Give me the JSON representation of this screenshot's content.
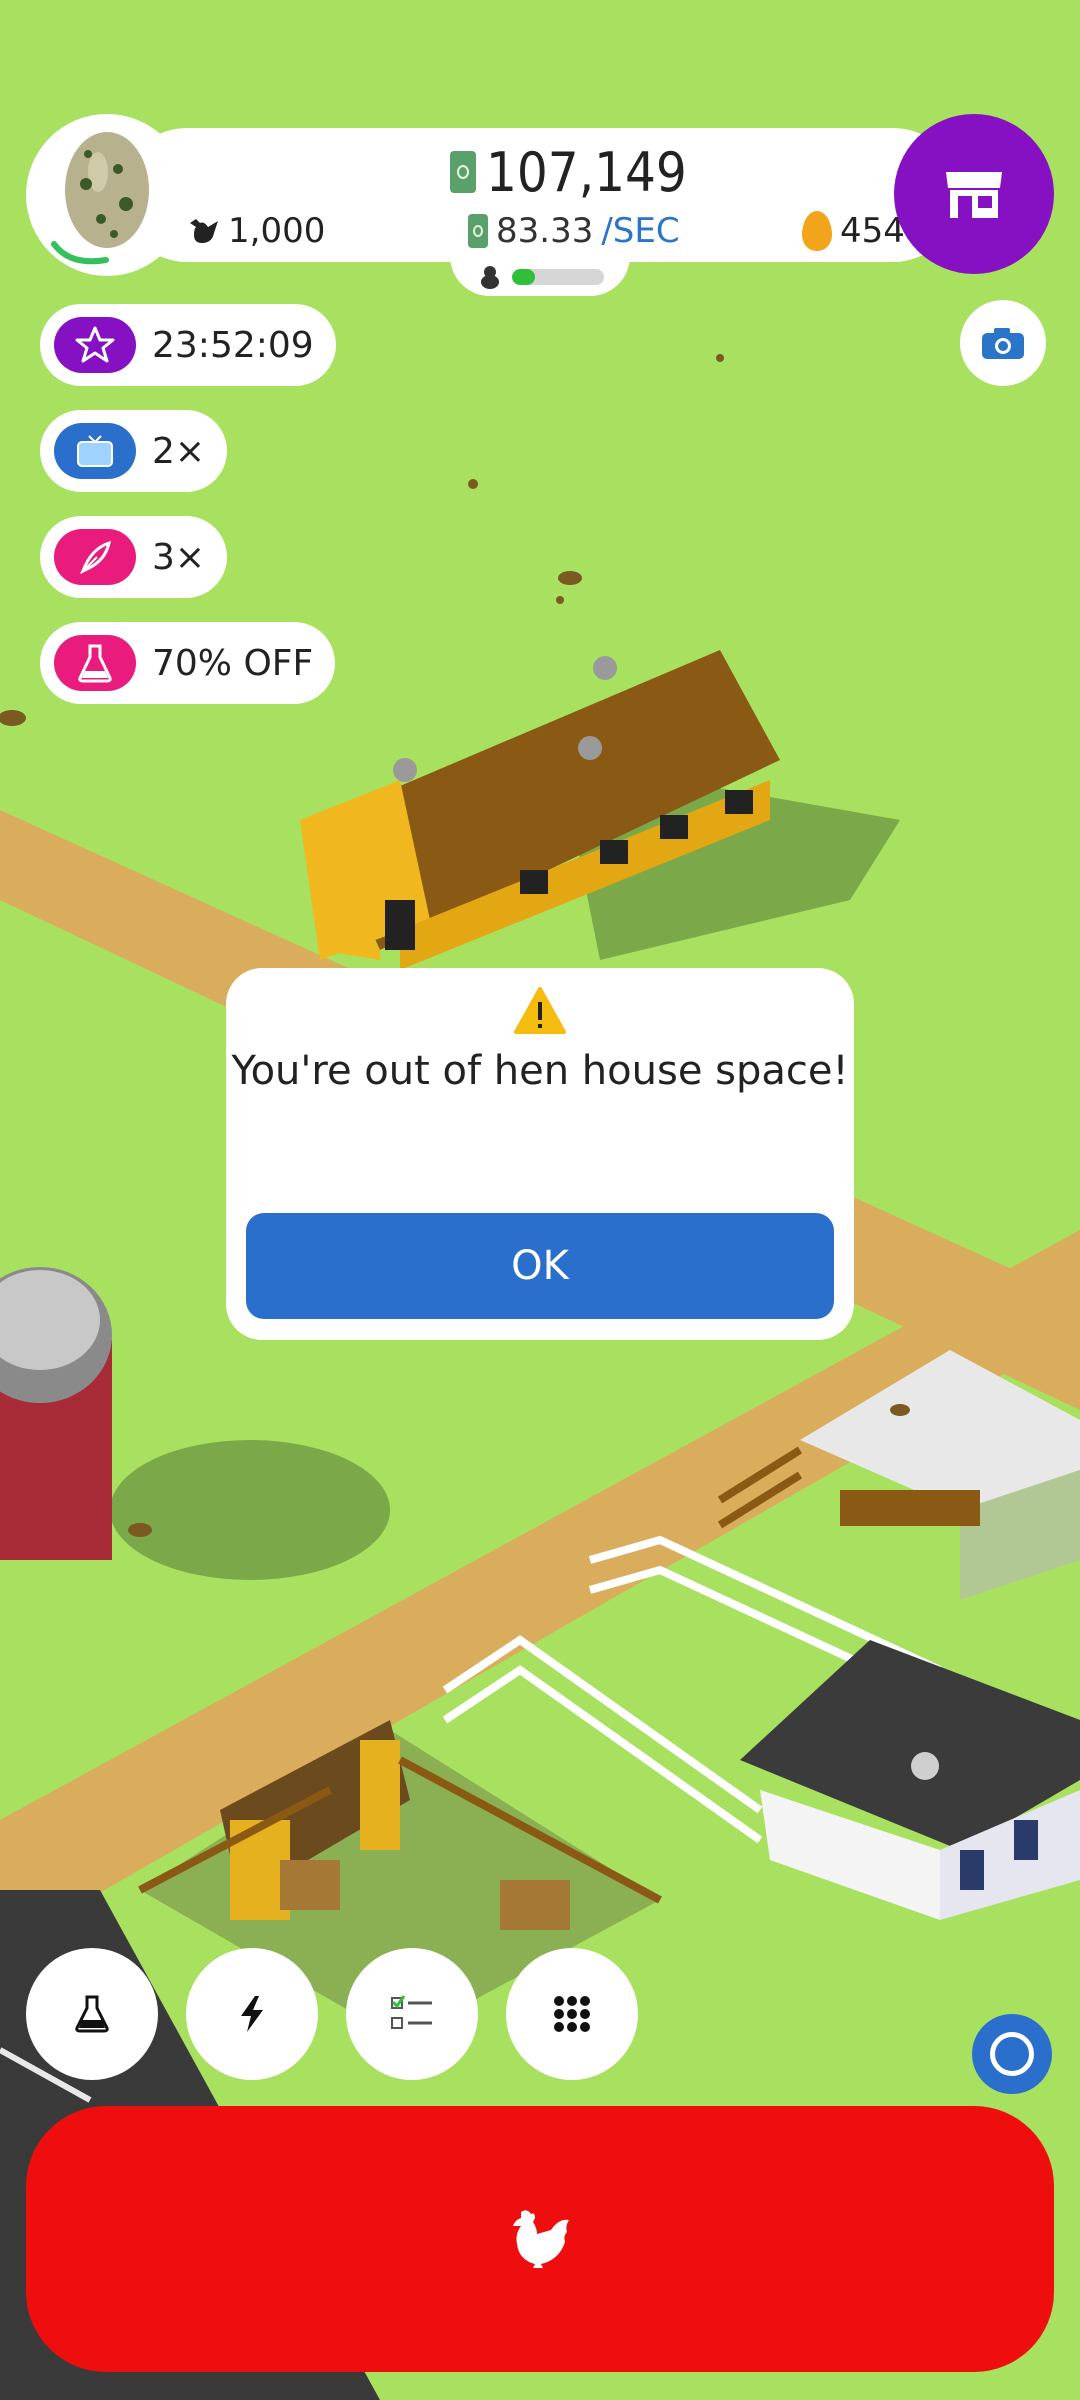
{
  "hud": {
    "money_total": "107,149",
    "money_rate": "83.33",
    "money_rate_unit": "/SEC",
    "chicken_count": "1,000",
    "golden_eggs": "454",
    "hatchery_progress": 0.25,
    "egg_progress": 0.3
  },
  "boosts": [
    {
      "label": "23:52:09",
      "icon": "star-icon",
      "color": "#8511c2"
    },
    {
      "label": "2×",
      "icon": "tv-icon",
      "color": "#2a6fcc"
    },
    {
      "label": "3×",
      "icon": "feather-icon",
      "color": "#e91c7e"
    },
    {
      "label": "70% OFF",
      "icon": "flask-icon",
      "color": "#e91c7e"
    }
  ],
  "dialog": {
    "message": "You're out of hen house space!",
    "ok_label": "OK",
    "icon": "warning-icon"
  },
  "toolbar": {
    "items": [
      {
        "icon": "flask-icon"
      },
      {
        "icon": "lightning-icon"
      },
      {
        "icon": "checklist-icon"
      },
      {
        "icon": "grid-icon"
      }
    ],
    "hatch_icon": "chicken-icon"
  },
  "colors": {
    "grass": "#a8e05f",
    "path": "#d9ad5c",
    "shop": "#8511c2",
    "primary_blue": "#2a6fcc",
    "hatch_red": "#ee0e0e"
  }
}
